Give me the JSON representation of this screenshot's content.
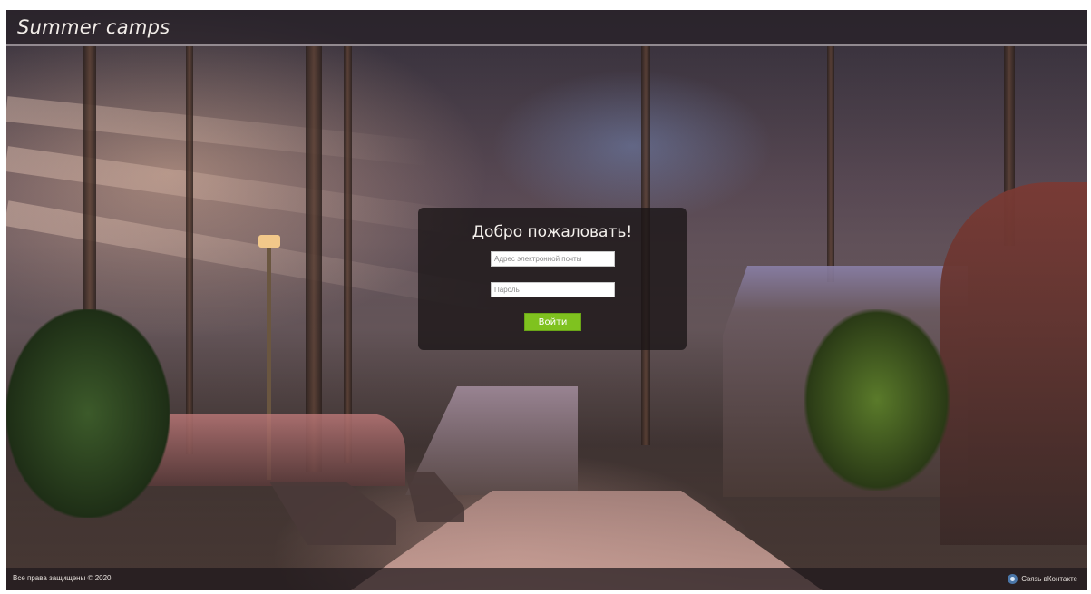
{
  "header": {
    "title": "Summer camps"
  },
  "login": {
    "title": "Добро пожаловать!",
    "email_placeholder": "Адрес электронной почты",
    "password_placeholder": "Пароль",
    "submit_label": "Войти"
  },
  "footer": {
    "copyright": "Все права защищены © 2020",
    "contact_label": "Связь вКонтакте",
    "contact_icon": "vk-icon"
  },
  "colors": {
    "button": "#7fc21f",
    "login_panel": "rgba(25,20,22,0.78)",
    "header_bar": "rgba(40,34,40,0.75)"
  }
}
